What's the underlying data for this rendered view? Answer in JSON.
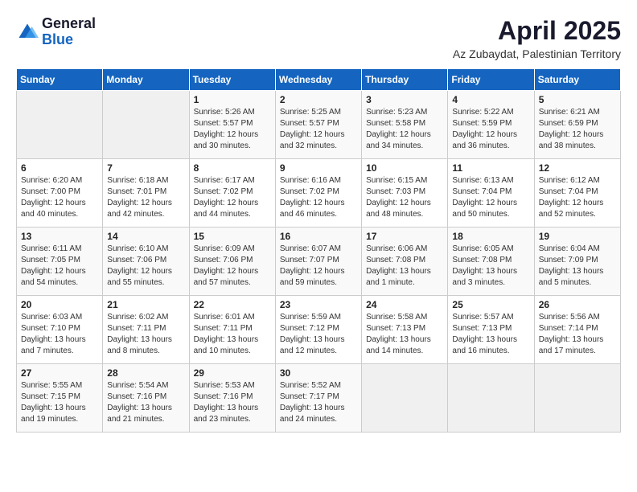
{
  "header": {
    "logo_general": "General",
    "logo_blue": "Blue",
    "month_title": "April 2025",
    "location": "Az Zubaydat, Palestinian Territory"
  },
  "weekdays": [
    "Sunday",
    "Monday",
    "Tuesday",
    "Wednesday",
    "Thursday",
    "Friday",
    "Saturday"
  ],
  "weeks": [
    [
      {
        "day": "",
        "info": ""
      },
      {
        "day": "",
        "info": ""
      },
      {
        "day": "1",
        "info": "Sunrise: 5:26 AM\nSunset: 5:57 PM\nDaylight: 12 hours\nand 30 minutes."
      },
      {
        "day": "2",
        "info": "Sunrise: 5:25 AM\nSunset: 5:57 PM\nDaylight: 12 hours\nand 32 minutes."
      },
      {
        "day": "3",
        "info": "Sunrise: 5:23 AM\nSunset: 5:58 PM\nDaylight: 12 hours\nand 34 minutes."
      },
      {
        "day": "4",
        "info": "Sunrise: 5:22 AM\nSunset: 5:59 PM\nDaylight: 12 hours\nand 36 minutes."
      },
      {
        "day": "5",
        "info": "Sunrise: 6:21 AM\nSunset: 6:59 PM\nDaylight: 12 hours\nand 38 minutes."
      }
    ],
    [
      {
        "day": "6",
        "info": "Sunrise: 6:20 AM\nSunset: 7:00 PM\nDaylight: 12 hours\nand 40 minutes."
      },
      {
        "day": "7",
        "info": "Sunrise: 6:18 AM\nSunset: 7:01 PM\nDaylight: 12 hours\nand 42 minutes."
      },
      {
        "day": "8",
        "info": "Sunrise: 6:17 AM\nSunset: 7:02 PM\nDaylight: 12 hours\nand 44 minutes."
      },
      {
        "day": "9",
        "info": "Sunrise: 6:16 AM\nSunset: 7:02 PM\nDaylight: 12 hours\nand 46 minutes."
      },
      {
        "day": "10",
        "info": "Sunrise: 6:15 AM\nSunset: 7:03 PM\nDaylight: 12 hours\nand 48 minutes."
      },
      {
        "day": "11",
        "info": "Sunrise: 6:13 AM\nSunset: 7:04 PM\nDaylight: 12 hours\nand 50 minutes."
      },
      {
        "day": "12",
        "info": "Sunrise: 6:12 AM\nSunset: 7:04 PM\nDaylight: 12 hours\nand 52 minutes."
      }
    ],
    [
      {
        "day": "13",
        "info": "Sunrise: 6:11 AM\nSunset: 7:05 PM\nDaylight: 12 hours\nand 54 minutes."
      },
      {
        "day": "14",
        "info": "Sunrise: 6:10 AM\nSunset: 7:06 PM\nDaylight: 12 hours\nand 55 minutes."
      },
      {
        "day": "15",
        "info": "Sunrise: 6:09 AM\nSunset: 7:06 PM\nDaylight: 12 hours\nand 57 minutes."
      },
      {
        "day": "16",
        "info": "Sunrise: 6:07 AM\nSunset: 7:07 PM\nDaylight: 12 hours\nand 59 minutes."
      },
      {
        "day": "17",
        "info": "Sunrise: 6:06 AM\nSunset: 7:08 PM\nDaylight: 13 hours\nand 1 minute."
      },
      {
        "day": "18",
        "info": "Sunrise: 6:05 AM\nSunset: 7:08 PM\nDaylight: 13 hours\nand 3 minutes."
      },
      {
        "day": "19",
        "info": "Sunrise: 6:04 AM\nSunset: 7:09 PM\nDaylight: 13 hours\nand 5 minutes."
      }
    ],
    [
      {
        "day": "20",
        "info": "Sunrise: 6:03 AM\nSunset: 7:10 PM\nDaylight: 13 hours\nand 7 minutes."
      },
      {
        "day": "21",
        "info": "Sunrise: 6:02 AM\nSunset: 7:11 PM\nDaylight: 13 hours\nand 8 minutes."
      },
      {
        "day": "22",
        "info": "Sunrise: 6:01 AM\nSunset: 7:11 PM\nDaylight: 13 hours\nand 10 minutes."
      },
      {
        "day": "23",
        "info": "Sunrise: 5:59 AM\nSunset: 7:12 PM\nDaylight: 13 hours\nand 12 minutes."
      },
      {
        "day": "24",
        "info": "Sunrise: 5:58 AM\nSunset: 7:13 PM\nDaylight: 13 hours\nand 14 minutes."
      },
      {
        "day": "25",
        "info": "Sunrise: 5:57 AM\nSunset: 7:13 PM\nDaylight: 13 hours\nand 16 minutes."
      },
      {
        "day": "26",
        "info": "Sunrise: 5:56 AM\nSunset: 7:14 PM\nDaylight: 13 hours\nand 17 minutes."
      }
    ],
    [
      {
        "day": "27",
        "info": "Sunrise: 5:55 AM\nSunset: 7:15 PM\nDaylight: 13 hours\nand 19 minutes."
      },
      {
        "day": "28",
        "info": "Sunrise: 5:54 AM\nSunset: 7:16 PM\nDaylight: 13 hours\nand 21 minutes."
      },
      {
        "day": "29",
        "info": "Sunrise: 5:53 AM\nSunset: 7:16 PM\nDaylight: 13 hours\nand 23 minutes."
      },
      {
        "day": "30",
        "info": "Sunrise: 5:52 AM\nSunset: 7:17 PM\nDaylight: 13 hours\nand 24 minutes."
      },
      {
        "day": "",
        "info": ""
      },
      {
        "day": "",
        "info": ""
      },
      {
        "day": "",
        "info": ""
      }
    ]
  ]
}
